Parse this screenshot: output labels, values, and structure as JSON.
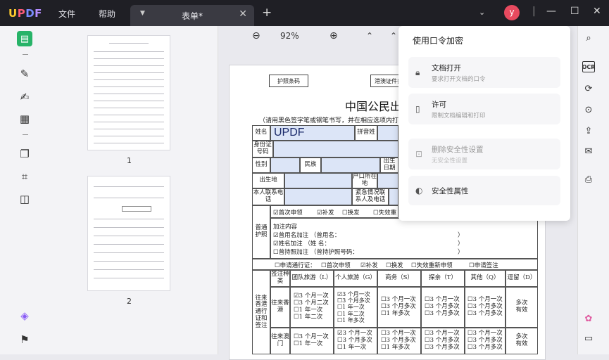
{
  "app": {
    "logo": "UPDF",
    "menu_file": "文件",
    "menu_help": "帮助"
  },
  "tab": {
    "title": "表单*"
  },
  "user": {
    "avatar_letter": "y"
  },
  "thumbs": {
    "page1": "1",
    "page2": "2"
  },
  "toolbar": {
    "zoom": "92%"
  },
  "document": {
    "passport_barcode": "护照条码",
    "hk_macau_barcode": "港澳证件条码",
    "title": "中国公民出入境证件申请表",
    "note": "（请用黑色签字笔或钢笔书写，并在相应选项内打",
    "name_label": "姓名",
    "name_value": "UPDF",
    "pinyin_label": "拼音姓",
    "id_label": "身份证号码",
    "gender_label": "性别",
    "ethnic_label": "民族",
    "birthdate_label": "出生日期",
    "birthplace_label": "出生地",
    "hukou_label": "户口所在地",
    "phone_label": "本人联系电话",
    "emergency_label": "紧急情况联系人及电话",
    "normal_passport": "普通护照",
    "first_apply": "☑首次申领",
    "reissue": "☑补发",
    "renew": "☐换发",
    "lost_reapply": "☐失效重",
    "endorsement": "加注内容",
    "former_name": "☑曾用名加注  （曾用名：",
    "name_note": "☑姓名加注    （姓    名：",
    "former_passport": "☐曾持照加注  （曾持护照号码：",
    "paren_close": "）",
    "travel_permit": "☐申请通行证：",
    "tp_first": "☐首次申领",
    "tp_reissue": "☑补发",
    "tp_renew": "☐换发",
    "tp_lost": "☐失效重新申领",
    "tp_sign": "☐申请签注",
    "sign_type": "签注种类",
    "group_tour": "团队旅游（L）",
    "personal_tour": "个人旅游（G）",
    "business": "商务（S）",
    "visit": "探亲（T）",
    "other": "其他（Q）",
    "stay": "逗留（D）",
    "hk_travel": "往来香港通行证和签注",
    "to_hk": "往来香港",
    "to_macau": "往来澳门",
    "g1": [
      "☑3 个月一次",
      "☐3 个月二次",
      "☐1 年一次",
      "☐1 年二次"
    ],
    "p1": [
      "☑3 个月一次",
      "☐3 个月多次",
      "☐1 年一次",
      "☐1 年二次",
      "☐1 年多次"
    ],
    "b1": [
      "☐3 个月一次",
      "☐3 个月多次",
      "☐1 年多次"
    ],
    "v1": [
      "☐3 个月一次",
      "☐3 个月多次",
      "☐3 个月多次"
    ],
    "o1": [
      "☐3 个月一次",
      "☐3 个月多次",
      "☐3 个月多次"
    ],
    "multi": "多次有效",
    "g2": [
      "☐3 个月一次",
      "☐1 年一次"
    ],
    "p2": [
      "☑3 个月一次",
      "☐3 个月多次",
      "☐1 年一次"
    ],
    "b2": [
      "☐3 个月一次",
      "☐3 个月多次",
      "☐1 年多次"
    ],
    "v2": [
      "☐3 个月一次",
      "☐3 个月多次",
      "☐3 个月多次"
    ],
    "o2": [
      "☐3 个月一次",
      "☐3 个月多次",
      "☐3 个月多次"
    ]
  },
  "popup": {
    "title": "使用口令加密",
    "open_title": "文档打开",
    "open_sub": "要求打开文档的口令",
    "perm_title": "许可",
    "perm_sub": "限制文档编辑和打印",
    "remove_title": "删除安全性设置",
    "remove_sub": "无安全性设置",
    "props_title": "安全性属性"
  },
  "icons": [
    "reader-icon",
    "comment-icon",
    "edit-icon",
    "form-icon",
    "organize-icon",
    "crop-icon",
    "layers-icon",
    "bookmark-icon",
    "search-icon",
    "ocr-icon",
    "convert-icon",
    "protect-icon",
    "share-icon",
    "mail-icon",
    "save-icon",
    "ai-icon",
    "chat-icon"
  ]
}
